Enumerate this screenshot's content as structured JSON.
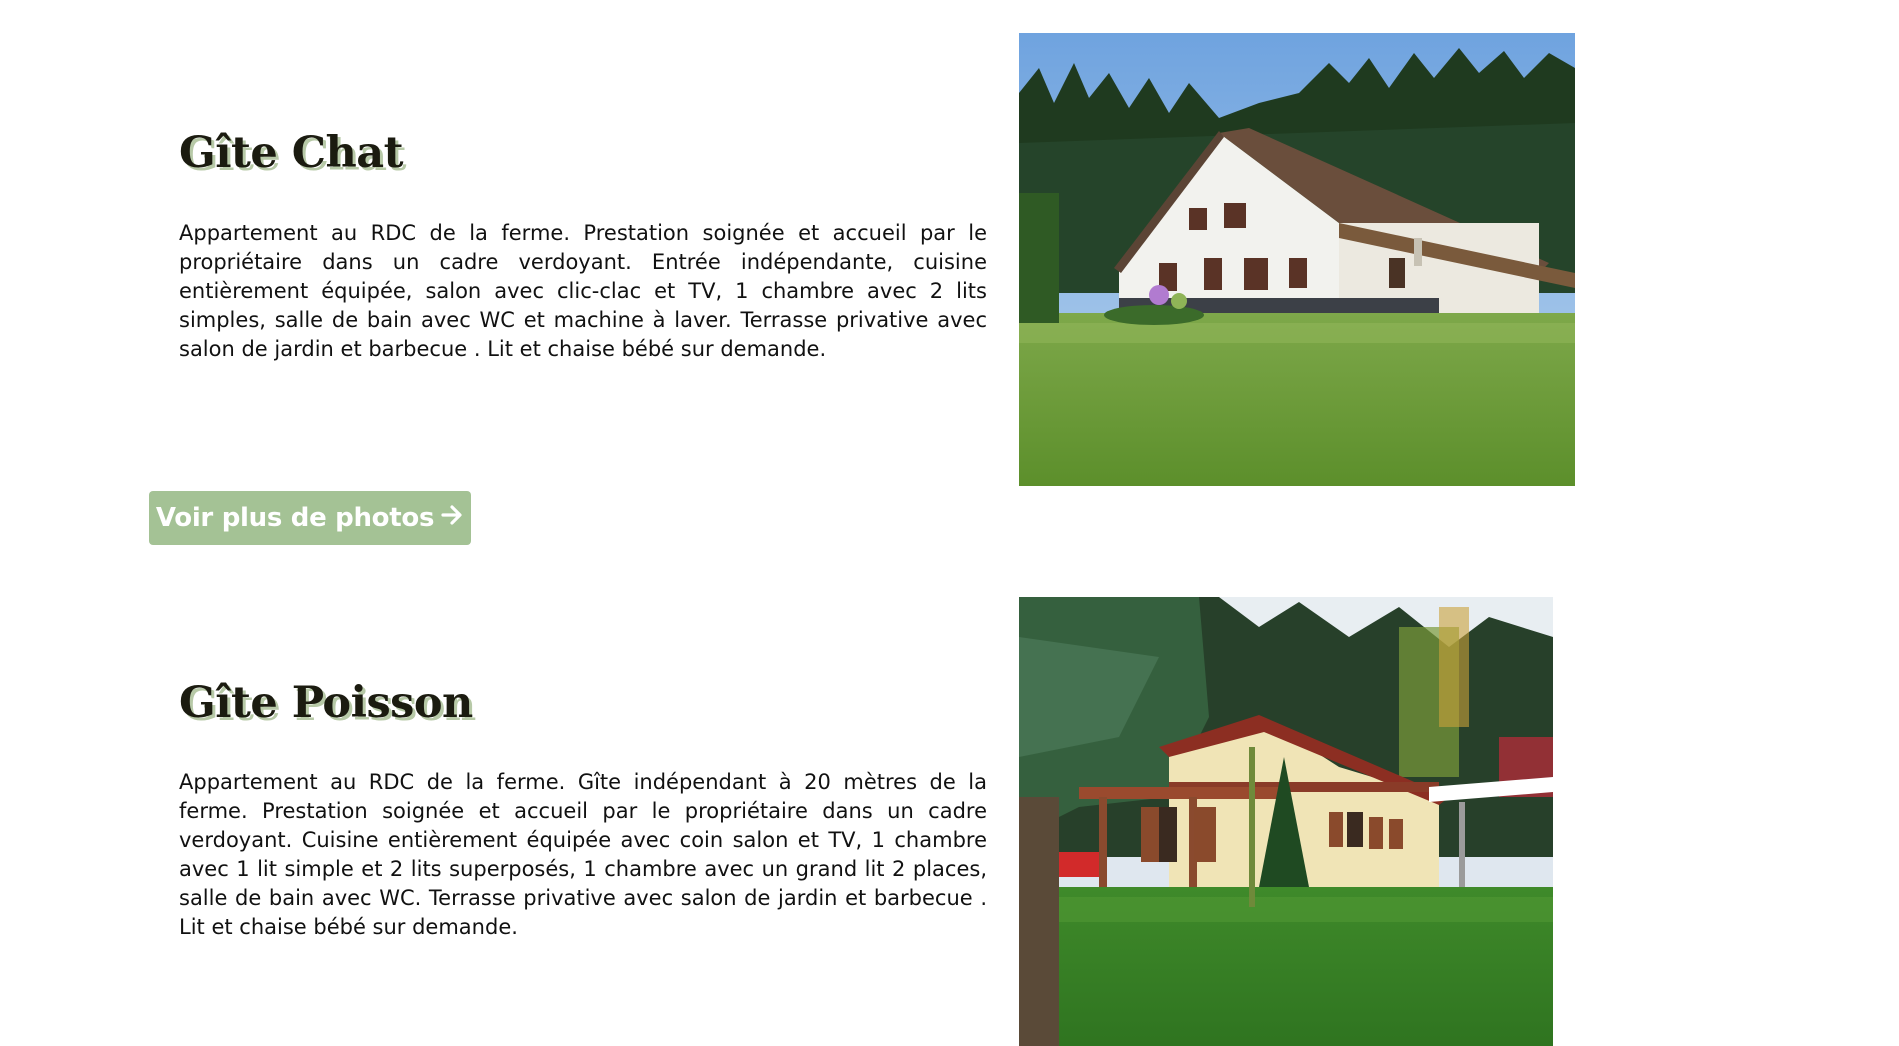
{
  "gites": [
    {
      "title": "Gîte Chat",
      "description": "Appartement au RDC de la ferme. Prestation soignée et accueil par le propriétaire dans un cadre verdoyant. Entrée indépendante, cuisine entièrement équipée, salon avec clic-clac et TV, 1 chambre avec 2 lits simples, salle de bain avec WC et machine à laver. Terrasse privative avec salon de jardin et barbecue . Lit et chaise bébé sur demande."
    },
    {
      "title": "Gîte Poisson",
      "description": "Appartement au RDC de la ferme. Gîte indépendant à 20 mètres de la ferme. Prestation soignée et accueil par le propriétaire dans un cadre verdoyant. Cuisine entièrement équipée avec coin salon et TV, 1 chambre avec 1 lit simple et 2 lits superposés, 1 chambre avec un grand lit 2 places, salle de bain avec WC. Terrasse privative avec salon de jardin et barbecue . Lit et chaise bébé sur demande."
    }
  ],
  "more_photos_button": {
    "label": "Voir plus de photos",
    "icon": "arrow-right-icon"
  },
  "colors": {
    "button_bg": "#a4c295",
    "title_shadow": "#b7c9a7",
    "text": "#111111"
  }
}
